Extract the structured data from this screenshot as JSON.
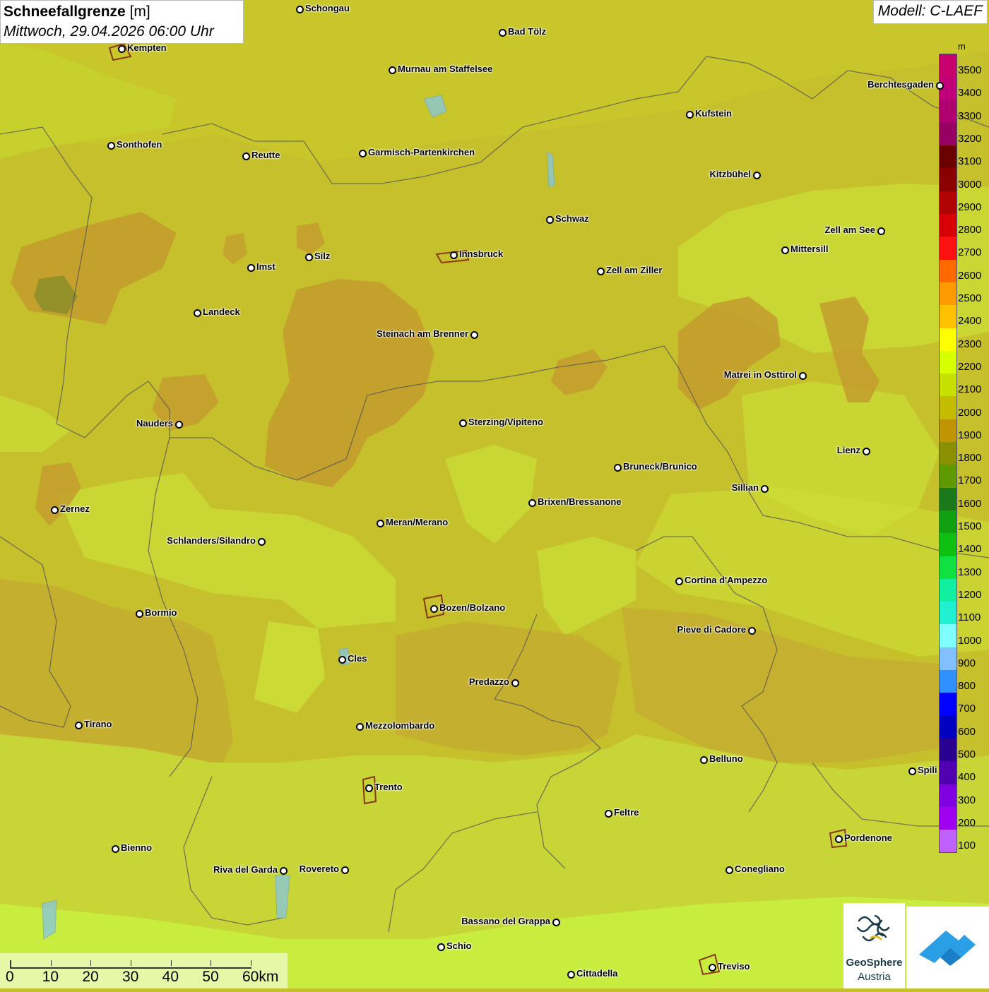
{
  "title": {
    "main": "Schneefallgrenze",
    "unit": "[m]",
    "datetime": "Mittwoch, 29.04.2026 06:00 Uhr"
  },
  "model": "Modell: C-LAEF",
  "legend": {
    "unit": "m",
    "labels": [
      "3500",
      "3400",
      "3300",
      "3200",
      "3100",
      "3000",
      "2900",
      "2800",
      "2700",
      "2600",
      "2500",
      "2400",
      "2300",
      "2200",
      "2100",
      "2000",
      "1900",
      "1800",
      "1700",
      "1600",
      "1500",
      "1400",
      "1300",
      "1200",
      "1100",
      "1000",
      "900",
      "800",
      "700",
      "600",
      "500",
      "400",
      "300",
      "200",
      "100"
    ],
    "colors": [
      "#c8006e",
      "#c0007a",
      "#b00070",
      "#960060",
      "#6a0000",
      "#8a0000",
      "#b00000",
      "#d80000",
      "#ff1010",
      "#ff6a00",
      "#ff9a00",
      "#ffc000",
      "#ffff00",
      "#d6ff00",
      "#c8e000",
      "#c4bc00",
      "#c09400",
      "#8a9000",
      "#5e9a00",
      "#1a7a1a",
      "#10a010",
      "#10c010",
      "#10e040",
      "#10f0a0",
      "#20f0d0",
      "#80ffff",
      "#80c0ff",
      "#3090ff",
      "#0000ff",
      "#0000c0",
      "#2a0090",
      "#5000b0",
      "#8000e0",
      "#a000f0",
      "#c060ff"
    ]
  },
  "cities": [
    {
      "name": "Schongau"
    },
    {
      "name": "Bad Tölz"
    },
    {
      "name": "Kempten"
    },
    {
      "name": "Murnau am Staffelsee"
    },
    {
      "name": "Berchtesgaden"
    },
    {
      "name": "Kufstein"
    },
    {
      "name": "Sonthofen"
    },
    {
      "name": "Reutte"
    },
    {
      "name": "Garmisch-Partenkirchen"
    },
    {
      "name": "Kitzbühel"
    },
    {
      "name": "Schwaz"
    },
    {
      "name": "Zell am See"
    },
    {
      "name": "Innsbruck"
    },
    {
      "name": "Mittersill"
    },
    {
      "name": "Imst"
    },
    {
      "name": "Silz"
    },
    {
      "name": "Zell am Ziller"
    },
    {
      "name": "Landeck"
    },
    {
      "name": "Steinach am Brenner"
    },
    {
      "name": "Matrei in Osttirol"
    },
    {
      "name": "Nauders"
    },
    {
      "name": "Sterzing/Vipiteno"
    },
    {
      "name": "Lienz"
    },
    {
      "name": "Bruneck/Brunico"
    },
    {
      "name": "Sillian"
    },
    {
      "name": "Zernez"
    },
    {
      "name": "Brixen/Bressanone"
    },
    {
      "name": "Meran/Merano"
    },
    {
      "name": "Schlanders/Silandro"
    },
    {
      "name": "Cortina d'Ampezzo"
    },
    {
      "name": "Bozen/Bolzano"
    },
    {
      "name": "Bormio"
    },
    {
      "name": "Pieve di Cadore"
    },
    {
      "name": "Cles"
    },
    {
      "name": "Predazzo"
    },
    {
      "name": "Tirano"
    },
    {
      "name": "Mezzolombardo"
    },
    {
      "name": "Belluno"
    },
    {
      "name": "Spili"
    },
    {
      "name": "Trento"
    },
    {
      "name": "Feltre"
    },
    {
      "name": "Pordenone"
    },
    {
      "name": "Bienno"
    },
    {
      "name": "Riva del Garda"
    },
    {
      "name": "Rovereto"
    },
    {
      "name": "Conegliano"
    },
    {
      "name": "Bassano del Grappa"
    },
    {
      "name": "Schio"
    },
    {
      "name": "Treviso"
    },
    {
      "name": "Cittadella"
    }
  ],
  "scale": {
    "labels": [
      "0",
      "10",
      "20",
      "30",
      "40",
      "50",
      "60km"
    ]
  },
  "logo": {
    "line1": "GeoSphere",
    "line2": "Austria"
  }
}
